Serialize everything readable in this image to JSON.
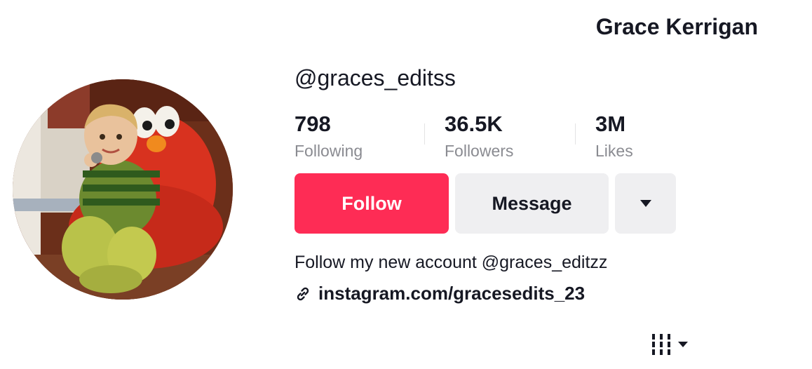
{
  "profile": {
    "display_name": "Grace Kerrigan",
    "username": "@graces_editss"
  },
  "stats": {
    "following": {
      "value": "798",
      "label": "Following"
    },
    "followers": {
      "value": "36.5K",
      "label": "Followers"
    },
    "likes": {
      "value": "3M",
      "label": "Likes"
    }
  },
  "actions": {
    "follow_label": "Follow",
    "message_label": "Message",
    "more_icon": "caret-down-icon"
  },
  "bio": {
    "text": "Follow my new account @graces_editzz",
    "link_icon": "link-icon",
    "link_text": "instagram.com/gracesedits_23"
  },
  "view_toggle": {
    "icon": "grid-view-icon",
    "dropdown_icon": "caret-down-icon"
  },
  "colors": {
    "follow_button": "#fe2c55",
    "secondary_button": "#efeff1",
    "primary_text": "#161823",
    "secondary_text": "#8a8b91"
  }
}
